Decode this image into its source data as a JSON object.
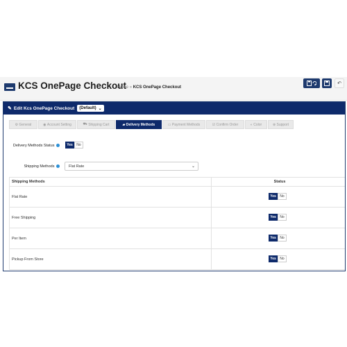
{
  "header": {
    "title": "KCS OnePage Checkout",
    "breadcrumb": {
      "home": "Home",
      "separator": "»",
      "current": "KCS OnePage Checkout"
    },
    "buttons": {
      "save_icon": "save-icon",
      "save_stay_icon": "save-refresh-icon",
      "back_icon": "back-arrow-icon"
    }
  },
  "panel": {
    "title": "Edit Kcs OnePage Checkout",
    "store": "(Default)"
  },
  "tabs": [
    {
      "label": "General",
      "icon": "gear-icon"
    },
    {
      "label": "Account Setting",
      "icon": "eye-icon"
    },
    {
      "label": "Shipping Cart",
      "icon": "cart-icon"
    },
    {
      "label": "Delivery Methods",
      "icon": "truck-icon",
      "active": true
    },
    {
      "label": "Payment Methods",
      "icon": "card-icon"
    },
    {
      "label": "Confirm Order",
      "icon": "check-icon"
    },
    {
      "label": "Color",
      "icon": "palette-icon"
    },
    {
      "label": "Support",
      "icon": "support-icon"
    }
  ],
  "form": {
    "delivery_status_label": "Delivery Methods Status",
    "yes": "Yes",
    "no": "No",
    "shipping_methods_label": "Shipping Methods",
    "shipping_methods_value": "Flat Rate"
  },
  "table": {
    "headers": [
      "Shipping Methods",
      "Status"
    ],
    "rows": [
      {
        "name": "Flat Rate",
        "status": "Yes"
      },
      {
        "name": "Free Shipping",
        "status": "Yes"
      },
      {
        "name": "Per Item",
        "status": "Yes"
      },
      {
        "name": "Pickup From Store",
        "status": "Yes"
      }
    ]
  },
  "colors": {
    "primary": "#0e2a6b",
    "help": "#2a8fd6"
  }
}
